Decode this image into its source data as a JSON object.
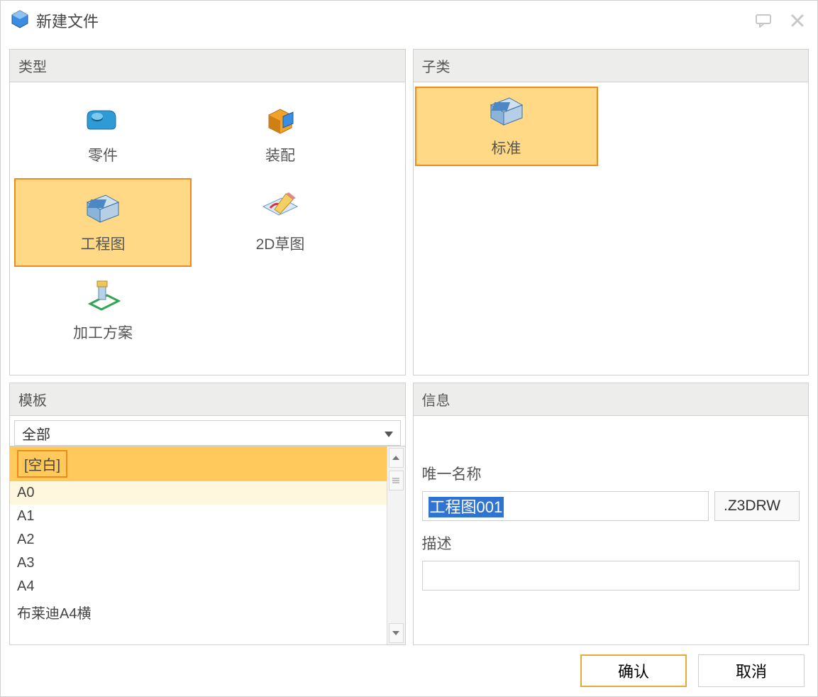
{
  "title": "新建文件",
  "panels": {
    "type": "类型",
    "subtype": "子类",
    "template": "模板",
    "info": "信息"
  },
  "types": [
    {
      "label": "零件"
    },
    {
      "label": "装配"
    },
    {
      "label": "工程图"
    },
    {
      "label": "2D草图"
    },
    {
      "label": "加工方案"
    }
  ],
  "subtype": {
    "label": "标准"
  },
  "template_filter": "全部",
  "templates": [
    "[空白]",
    "A0",
    "A1",
    "A2",
    "A3",
    "A4",
    "布莱迪A4横"
  ],
  "info": {
    "name_label": "唯一名称",
    "name_value": "工程图001",
    "ext": ".Z3DRW",
    "desc_label": "描述",
    "desc_value": ""
  },
  "buttons": {
    "ok": "确认",
    "cancel": "取消"
  }
}
